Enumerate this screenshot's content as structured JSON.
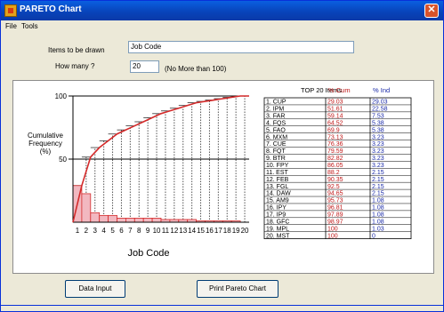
{
  "window": {
    "title": "PARETO Chart",
    "close_label": "✕"
  },
  "menu": {
    "items": [
      "File",
      "Tools"
    ]
  },
  "form": {
    "items_label": "Items to be drawn",
    "items_value": "Job Code",
    "count_label": "How many ?",
    "count_value": "20",
    "count_hint": "(No More than 100)"
  },
  "buttons": {
    "data_input": "Data Input",
    "print": "Print Pareto Chart"
  },
  "colors": {
    "cum_line": "#d42a2a",
    "bar_fill": "#f2b8c0",
    "bar_stroke": "#d42a2a",
    "pct_text": "#c01818",
    "ind_text": "#1a2aa8"
  },
  "chart_data": {
    "type": "bar",
    "xlabel": "Job Code",
    "ylabel": "Cumulative Frequency (%)",
    "ylim": [
      0,
      100
    ],
    "yticks": [
      50,
      100
    ],
    "categories": [
      "1",
      "2",
      "3",
      "4",
      "5",
      "6",
      "7",
      "8",
      "9",
      "10",
      "11",
      "12",
      "13",
      "14",
      "15",
      "16",
      "17",
      "18",
      "19",
      "20"
    ],
    "series": [
      {
        "name": "% Cum",
        "values": [
          29.03,
          51.61,
          59.14,
          64.52,
          69.9,
          73.13,
          76.36,
          79.59,
          82.82,
          86.05,
          88.2,
          90.35,
          92.5,
          94.65,
          95.73,
          96.81,
          97.89,
          98.97,
          100,
          100
        ]
      },
      {
        "name": "% Ind",
        "values": [
          29.03,
          22.58,
          7.53,
          5.38,
          5.38,
          3.23,
          3.23,
          3.23,
          3.23,
          3.23,
          2.15,
          2.15,
          2.15,
          2.15,
          1.08,
          1.08,
          1.08,
          1.08,
          1.03,
          0
        ]
      }
    ]
  },
  "table": {
    "header": "TOP 20 Items",
    "col_cum": "% Cum",
    "col_ind": "% Ind",
    "rows": [
      {
        "item": "1. CUP",
        "cum": "29.03",
        "ind": "29.03"
      },
      {
        "item": "2. IPM",
        "cum": "51.61",
        "ind": "22.58"
      },
      {
        "item": "3. FAR",
        "cum": "59.14",
        "ind": "7.53"
      },
      {
        "item": "4. FQS",
        "cum": "64.52",
        "ind": "5.38"
      },
      {
        "item": "5. FAO",
        "cum": "69.9",
        "ind": "5.38"
      },
      {
        "item": "6. MXM",
        "cum": "73.13",
        "ind": "3.23"
      },
      {
        "item": "7. CUE",
        "cum": "76.36",
        "ind": "3.23"
      },
      {
        "item": "8. FQT",
        "cum": "79.59",
        "ind": "3.23"
      },
      {
        "item": "9. BTR",
        "cum": "82.82",
        "ind": "3.23"
      },
      {
        "item": "10. FPY",
        "cum": "86.05",
        "ind": "3.23"
      },
      {
        "item": "11. EST",
        "cum": "88.2",
        "ind": "2.15"
      },
      {
        "item": "12. FEB",
        "cum": "90.35",
        "ind": "2.15"
      },
      {
        "item": "13. FGL",
        "cum": "92.5",
        "ind": "2.15"
      },
      {
        "item": "14. DAW",
        "cum": "94.65",
        "ind": "2.15"
      },
      {
        "item": "15. AM9",
        "cum": "95.73",
        "ind": "1.08"
      },
      {
        "item": "16. IPY",
        "cum": "96.81",
        "ind": "1.08"
      },
      {
        "item": "17. IP9",
        "cum": "97.89",
        "ind": "1.08"
      },
      {
        "item": "18. GFC",
        "cum": "98.97",
        "ind": "1.08"
      },
      {
        "item": "19. MPL",
        "cum": "100",
        "ind": "1.03"
      },
      {
        "item": "20. MST",
        "cum": "100",
        "ind": "0"
      }
    ]
  }
}
